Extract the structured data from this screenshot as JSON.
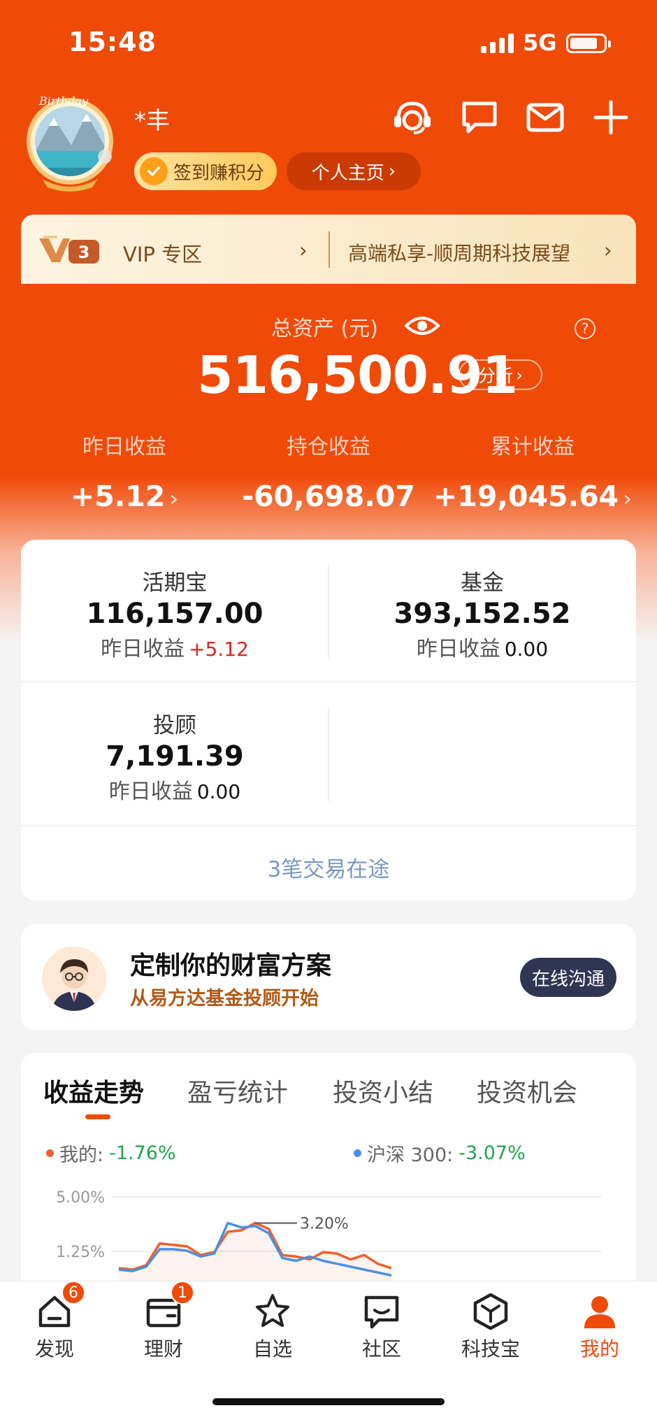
{
  "status_bar": {
    "time": "15:48",
    "network": "5G"
  },
  "profile": {
    "username": "*丰",
    "checkin_label": "签到赚积分",
    "homepage_label": "个人主页",
    "avatar_caption": "Birthday"
  },
  "header_icons": [
    "customer-service-icon",
    "chat-icon",
    "mail-icon",
    "plus-icon"
  ],
  "vip": {
    "level": "3",
    "label": "VIP 专区",
    "promo": "高端私享-顺周期科技展望"
  },
  "assets": {
    "label": "总资产 (元)",
    "total": "516,500.91",
    "analyze_label": "分析",
    "stats": [
      {
        "label": "昨日收益",
        "value": "+5.12",
        "has_arrow": true
      },
      {
        "label": "持仓收益",
        "value": "-60,698.07",
        "has_arrow": false
      },
      {
        "label": "累计收益",
        "value": "+19,045.64",
        "has_arrow": true
      }
    ]
  },
  "holdings": {
    "items": [
      {
        "name": "活期宝",
        "amount": "116,157.00",
        "sub_label": "昨日收益",
        "sub_value": "+5.12"
      },
      {
        "name": "基金",
        "amount": "393,152.52",
        "sub_label": "昨日收益",
        "sub_value": "0.00"
      },
      {
        "name": "投顾",
        "amount": "7,191.39",
        "sub_label": "昨日收益",
        "sub_value": "0.00"
      }
    ],
    "in_transit": "3笔交易在途"
  },
  "advisor": {
    "title": "定制你的财富方案",
    "subtitle": "从易方达基金投顾开始",
    "button": "在线沟通"
  },
  "trend": {
    "tabs": [
      "收益走势",
      "盈亏统计",
      "投资小结",
      "投资机会"
    ],
    "active_tab": 0,
    "legend": [
      {
        "name": "我的:",
        "value": "-1.76%",
        "color": "#f0602a"
      },
      {
        "name": "沪深 300:",
        "value": "-3.07%",
        "color": "#4a90e2"
      }
    ],
    "y_ticks": [
      "5.00%",
      "1.25%"
    ],
    "peak_label": "3.20%"
  },
  "chart_data": {
    "type": "line",
    "y_ticks": [
      5.0,
      1.25
    ],
    "series": [
      {
        "name": "我的",
        "color": "#f0602a",
        "values": [
          0.1,
          0.0,
          0.3,
          1.8,
          1.7,
          1.6,
          1.0,
          1.2,
          2.6,
          2.7,
          3.2,
          2.8,
          1.0,
          0.9,
          0.7,
          1.2,
          1.1,
          0.7,
          1.0,
          0.4,
          0.1
        ]
      },
      {
        "name": "沪深 300",
        "color": "#4a90e2",
        "values": [
          0.0,
          -0.1,
          0.2,
          1.4,
          1.4,
          1.3,
          0.9,
          1.1,
          3.2,
          2.9,
          3.0,
          2.5,
          0.8,
          0.6,
          0.9,
          0.6,
          0.4,
          0.2,
          0.0,
          -0.2,
          -0.4
        ]
      }
    ],
    "annotation": "3.20%"
  },
  "tabbar": {
    "items": [
      {
        "label": "发现",
        "icon": "home-icon",
        "badge": "6"
      },
      {
        "label": "理财",
        "icon": "wallet-icon",
        "badge": "1"
      },
      {
        "label": "自选",
        "icon": "star-icon",
        "badge": ""
      },
      {
        "label": "社区",
        "icon": "community-icon",
        "badge": ""
      },
      {
        "label": "科技宝",
        "icon": "cube-icon",
        "badge": ""
      },
      {
        "label": "我的",
        "icon": "user-icon",
        "badge": ""
      }
    ],
    "active": 5
  },
  "colors": {
    "brand": "#f04a08",
    "positive": "#e02020",
    "negative": "#1fa64a"
  }
}
